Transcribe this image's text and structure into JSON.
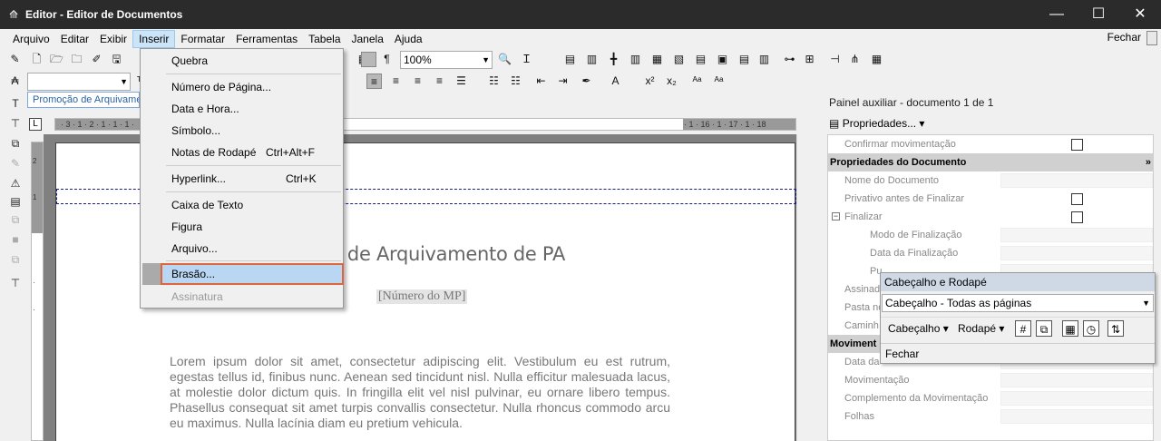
{
  "window": {
    "title": "Editor - Editor de Documentos",
    "controls": {
      "minimize": "—",
      "maximize": "☐",
      "close": "✕"
    }
  },
  "menubar": {
    "items": [
      "Arquivo",
      "Editar",
      "Exibir",
      "Inserir",
      "Formatar",
      "Ferramentas",
      "Tabela",
      "Janela",
      "Ajuda"
    ],
    "active": "Inserir",
    "right": "Fechar"
  },
  "toolbar": {
    "zoom": "100%",
    "style": "Promoção de Arquivamento"
  },
  "insert_menu": {
    "items": [
      {
        "label": "Quebra",
        "shortcut": ""
      },
      {
        "label": "Número de Página...",
        "shortcut": ""
      },
      {
        "label": "Data e Hora...",
        "shortcut": ""
      },
      {
        "label": "Símbolo...",
        "shortcut": ""
      },
      {
        "label": "Notas de Rodapé",
        "shortcut": "Ctrl+Alt+F"
      },
      {
        "label": "Hyperlink...",
        "shortcut": "Ctrl+K"
      },
      {
        "label": "Caixa de Texto",
        "shortcut": ""
      },
      {
        "label": "Figura",
        "shortcut": ""
      },
      {
        "label": "Arquivo...",
        "shortcut": ""
      },
      {
        "label": "Brasão...",
        "shortcut": ""
      },
      {
        "label": "Assinatura",
        "shortcut": ""
      }
    ],
    "highlighted": "Brasão..."
  },
  "document": {
    "title": "o de Arquivamento de PA",
    "subtitle": "[Número do MP]",
    "body": "Lorem ipsum dolor sit amet, consectetur adipiscing elit. Vestibulum eu est rutrum, egestas tellus id, finibus nunc. Aenean sed tincidunt nisl. Nulla efficitur malesuada lacus, at molestie dolor dictum quis. In fringilla elit vel nisl pulvinar, eu ornare libero tempus. Phasellus consequat sit amet turpis convallis consectetur. Nulla rhoncus commodo arcu eu maximus. Nulla lacínia diam eu pretium vehicula."
  },
  "panel": {
    "title": "Painel auxiliar - documento 1 de 1",
    "properties_button": "Propriedades...",
    "rows": [
      {
        "label": "Confirmar movimentação",
        "type": "check"
      },
      {
        "label": "Propriedades do Documento",
        "type": "section"
      },
      {
        "label": "Nome do Documento",
        "type": "value"
      },
      {
        "label": "Privativo antes de Finalizar",
        "type": "check"
      },
      {
        "label": "Finalizar",
        "type": "check"
      },
      {
        "label": "Modo de Finalização",
        "type": "value"
      },
      {
        "label": "Data da Finalização",
        "type": "value"
      },
      {
        "label": "Pu",
        "type": "value"
      },
      {
        "label": "Assinad",
        "type": "value"
      },
      {
        "label": "Pasta no",
        "type": "value"
      },
      {
        "label": "Caminh",
        "type": "value"
      },
      {
        "label": "Moviment",
        "type": "section"
      },
      {
        "label": "Data da",
        "type": "value"
      },
      {
        "label": "Movimentação",
        "type": "value"
      },
      {
        "label": "Complemento da Movimentação",
        "type": "value"
      },
      {
        "label": "Folhas",
        "type": "value"
      }
    ]
  },
  "header_footer_toolbar": {
    "title": "Cabeçalho e Rodapé",
    "selected": "Cabeçalho -  Todas as páginas",
    "header_button": "Cabeçalho",
    "footer_button": "Rodapé",
    "close": "Fechar"
  }
}
